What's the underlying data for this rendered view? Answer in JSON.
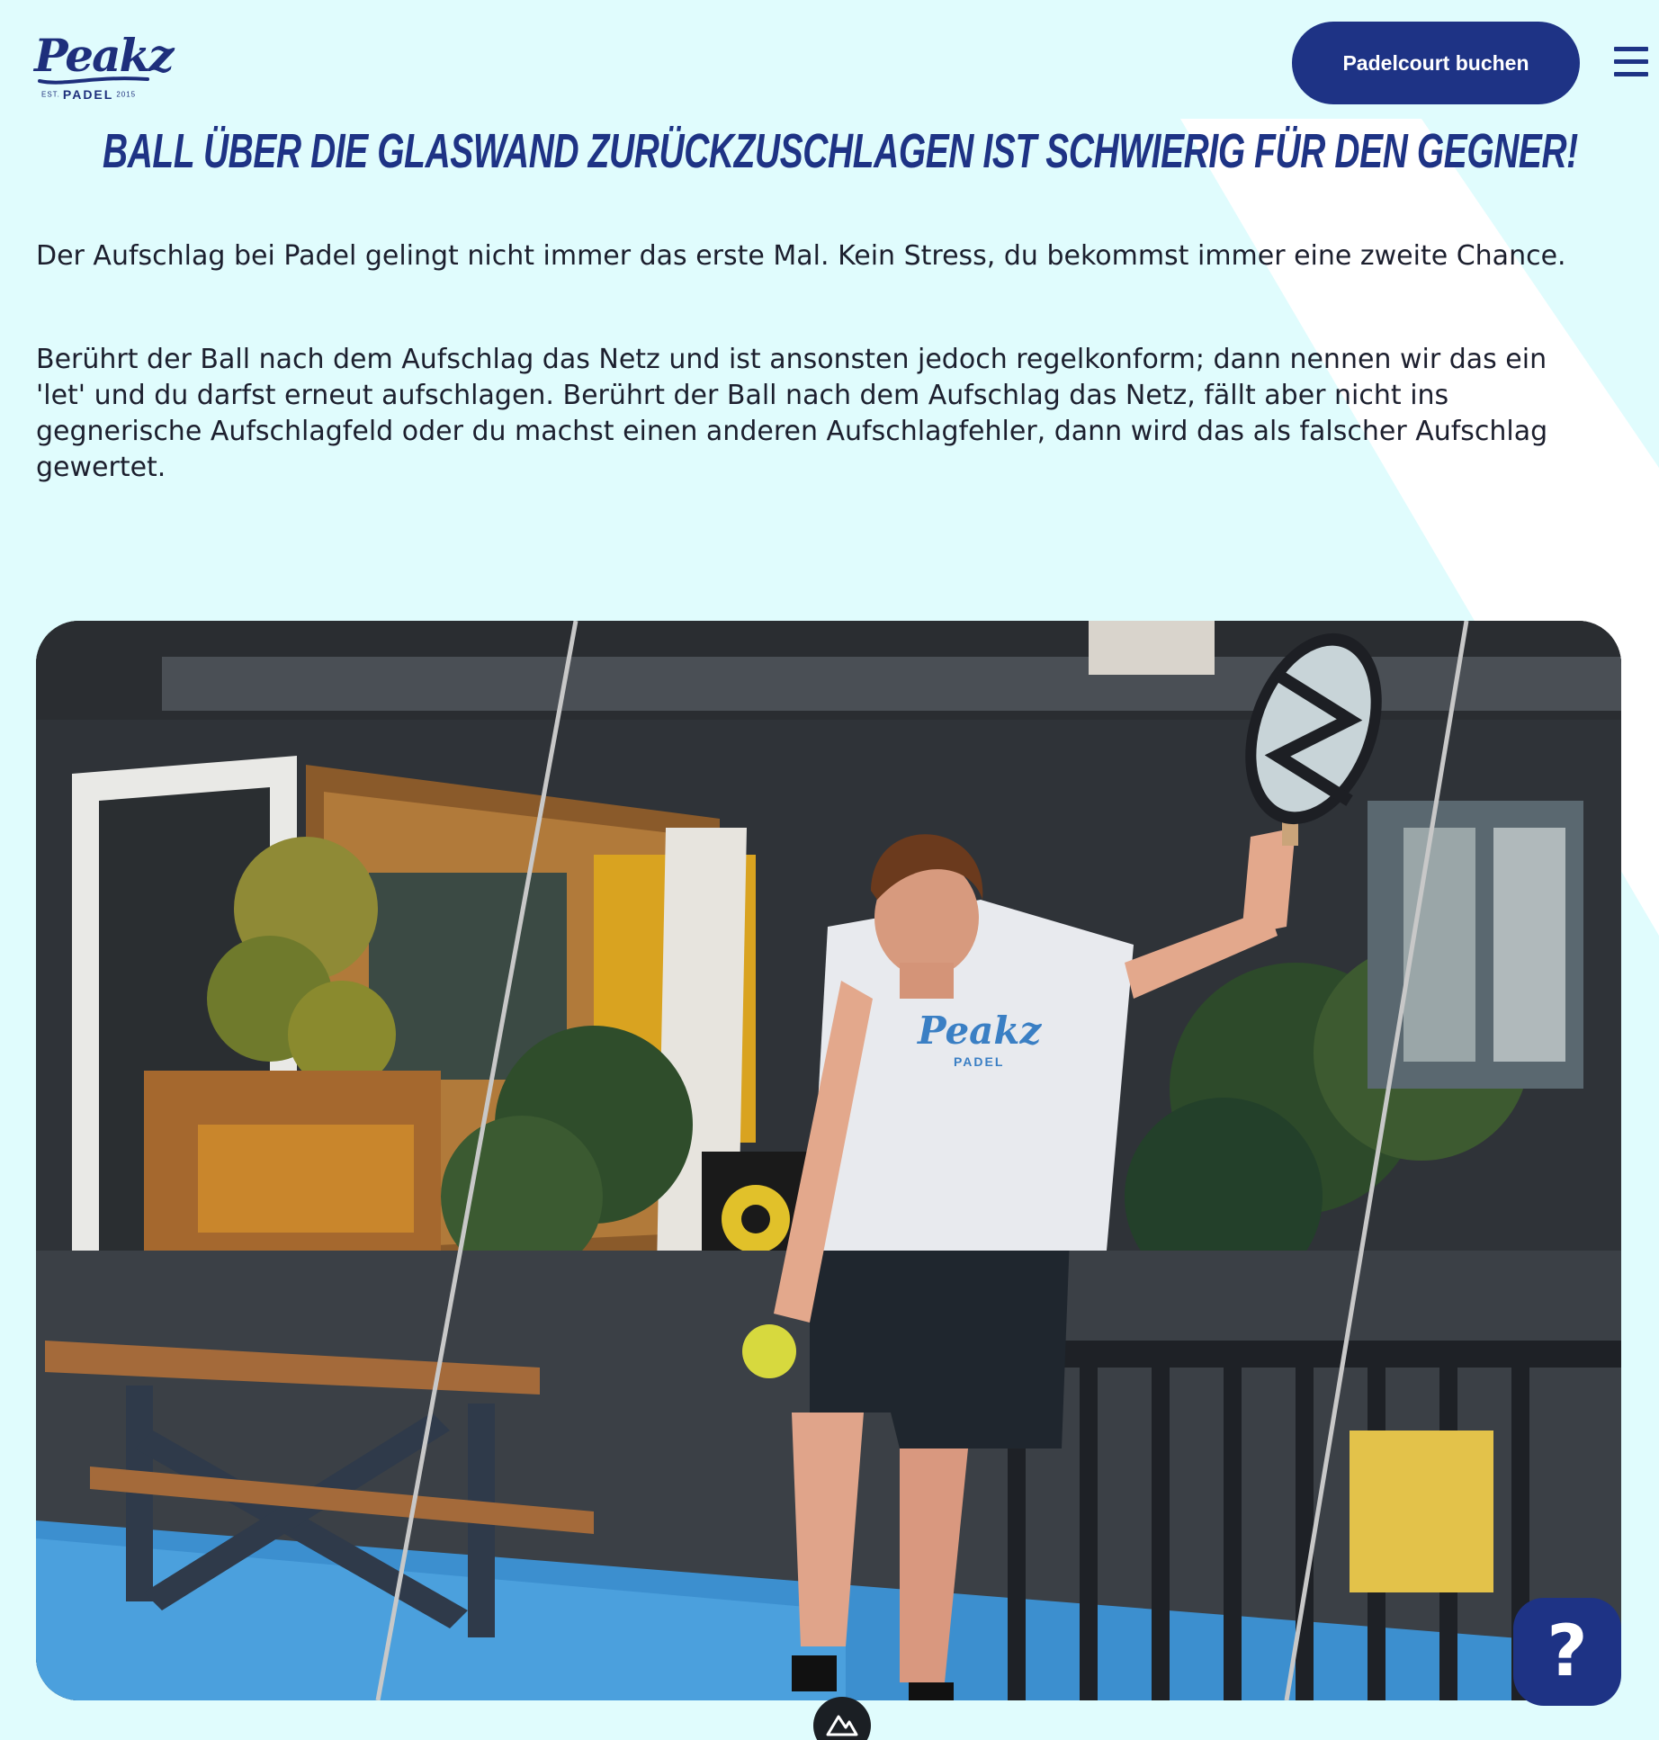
{
  "header": {
    "logo": {
      "wordmark": "Peakz",
      "est": "EST.",
      "brand_sub": "PADEL",
      "year": "2015"
    },
    "book_button_label": "Padelcourt buchen",
    "menu_icon": "hamburger-menu-icon"
  },
  "main": {
    "heading": "Ball über die Glaswand zurückzuschlagen ist schwierig für den Gegner!",
    "paragraphs": [
      "Der Aufschlag bei Padel gelingt nicht immer das erste Mal. Kein Stress, du bekommst immer eine zweite Chance.",
      "Berührt der Ball nach dem Aufschlag das Netz und ist ansonsten jedoch regelkonform; dann nennen wir das ein 'let' und du darfst erneut aufschlagen. Berührt der Ball nach dem Aufschlag das Netz, fällt aber nicht ins gegnerische Aufschlagfeld oder du machst einen anderen Aufschlagfehler, dann wird das als falscher Aufschlag gewertet."
    ],
    "photo": {
      "shirt_print": "Peakz",
      "shirt_sub": "PADEL"
    }
  },
  "help_button": {
    "label": "?"
  },
  "bottom_badge_icon": "mountain-logo-icon",
  "colors": {
    "background": "#e0fcfd",
    "brand_navy": "#1e3385",
    "text": "#1c1f2e",
    "accent_stripe": "#ffffff"
  }
}
